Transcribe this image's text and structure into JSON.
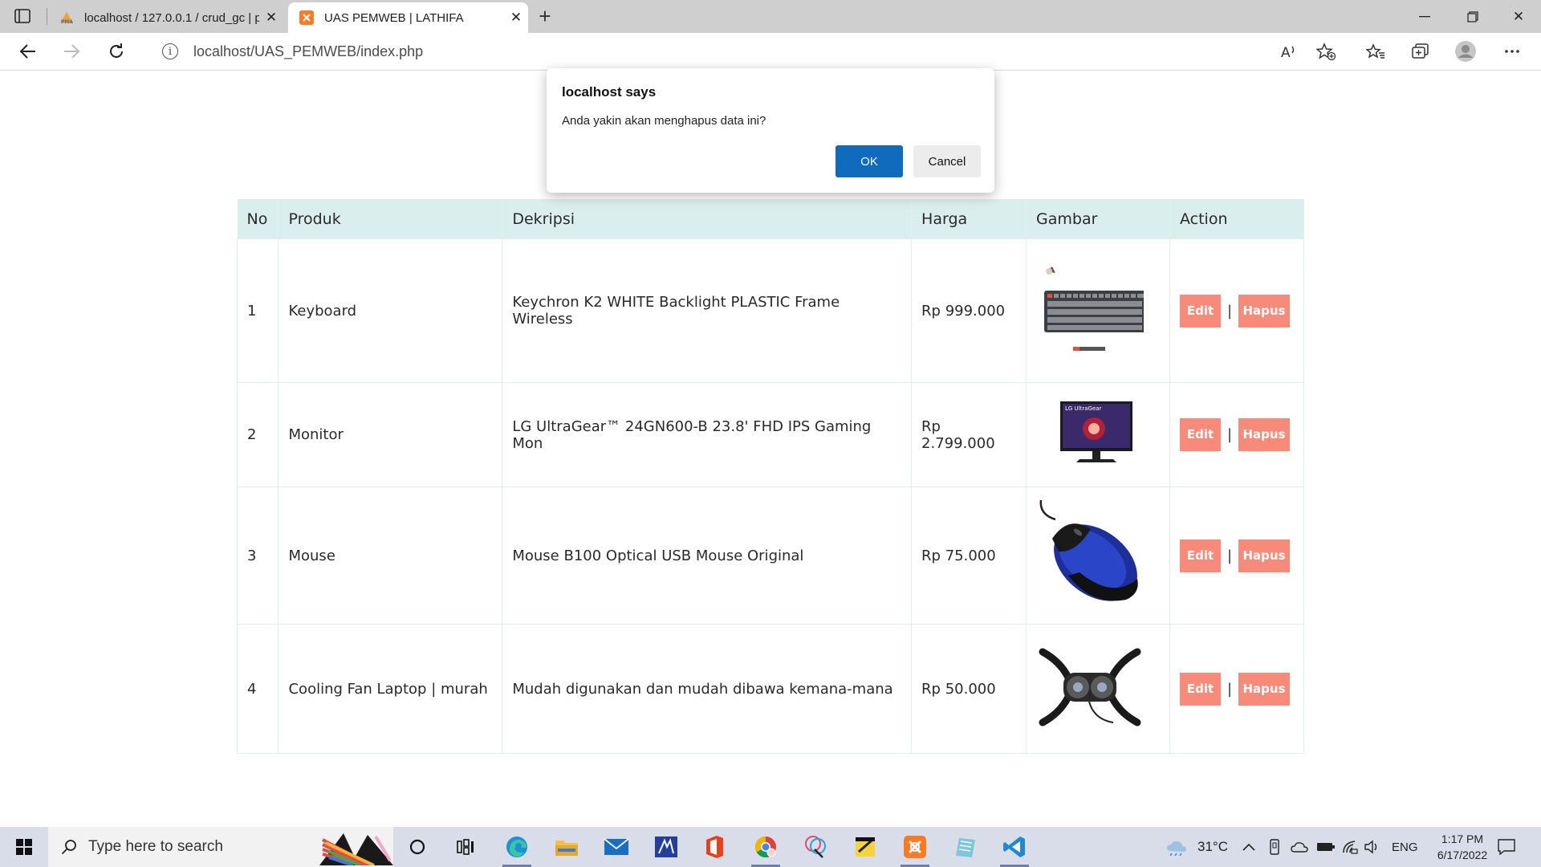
{
  "browser": {
    "tabs": [
      {
        "title": "localhost / 127.0.0.1 / crud_gc | p",
        "active": false
      },
      {
        "title": "UAS PEMWEB | LATHIFA",
        "active": true
      }
    ],
    "url": "localhost/UAS_PEMWEB/index.php",
    "icons": [
      "tab-actions-icon",
      "pma-favicon",
      "xampp-favicon",
      "close-icon",
      "new-tab-icon",
      "minimize-icon",
      "maximize-icon",
      "window-close-icon",
      "back-icon",
      "forward-icon",
      "refresh-icon",
      "info-icon",
      "read-aloud-icon",
      "add-favorite-icon",
      "favorites-icon",
      "collections-icon",
      "profile-icon",
      "more-icon"
    ]
  },
  "dialog": {
    "title": "localhost says",
    "message": "Anda yakin akan menghapus data ini?",
    "ok_label": "OK",
    "cancel_label": "Cancel",
    "ok_color": "#0f6cbd"
  },
  "table": {
    "headers": [
      "No",
      "Produk",
      "Dekripsi",
      "Harga",
      "Gambar",
      "Action"
    ],
    "header_bg": "#dbeeee",
    "rows": [
      {
        "no": "1",
        "produk": "Keyboard",
        "deskripsi": "Keychron K2 WHITE Backlight PLASTIC Frame Wireless",
        "harga": "Rp 999.000",
        "image": "keyboard"
      },
      {
        "no": "2",
        "produk": "Monitor",
        "deskripsi": "LG UltraGear™ 24GN600-B 23.8' FHD IPS Gaming Mon",
        "harga": "Rp 2.799.000",
        "image": "monitor",
        "image_caption": "LG UltraGear"
      },
      {
        "no": "3",
        "produk": "Mouse",
        "deskripsi": "Mouse B100 Optical USB Mouse Original",
        "harga": "Rp 75.000",
        "image": "mouse"
      },
      {
        "no": "4",
        "produk": "Cooling Fan Laptop | murah",
        "deskripsi": "Mudah digunakan dan mudah dibawa kemana-mana",
        "harga": "Rp 50.000",
        "image": "cooling-fan"
      }
    ],
    "edit_label": "Edit",
    "delete_label": "Hapus",
    "separator": "|",
    "button_color": "#f88a79"
  },
  "taskbar": {
    "search_placeholder": "Type here to search",
    "apps": [
      "cortana-icon",
      "task-view-icon",
      "edge-icon",
      "file-explorer-icon",
      "mail-icon",
      "app-icon",
      "office-icon",
      "chrome-icon",
      "paint-icon",
      "sticky-notes-icon",
      "xampp-icon",
      "notepad-icon",
      "vscode-icon"
    ],
    "weather": "31°C",
    "language": "ENG",
    "time": "1:17 PM",
    "date": "6/17/2022"
  }
}
